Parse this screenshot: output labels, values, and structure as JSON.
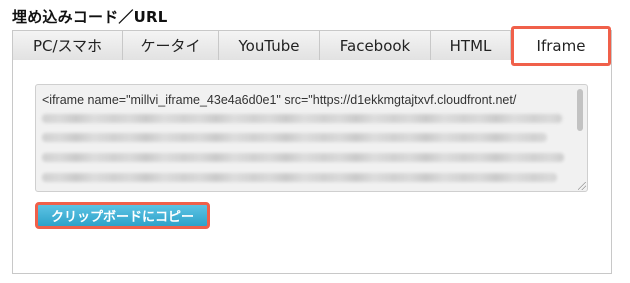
{
  "section": {
    "title": "埋め込みコード／URL"
  },
  "tabs": [
    {
      "label": "PC/スマホ",
      "active": false
    },
    {
      "label": "ケータイ",
      "active": false
    },
    {
      "label": "YouTube",
      "active": false
    },
    {
      "label": "Facebook",
      "active": false
    },
    {
      "label": "HTML",
      "active": false
    },
    {
      "label": "Iframe",
      "active": true
    }
  ],
  "code": {
    "first_line": "<iframe name=\"millvi_iframe_43e4a6d0e1\" src=\"https://d1ekkmgtajtxvf.cloudfront.net/"
  },
  "copy_button": {
    "label": "クリップボードにコピー"
  },
  "colors": {
    "highlight": "#f0604a",
    "button": "#2ea2c9"
  }
}
